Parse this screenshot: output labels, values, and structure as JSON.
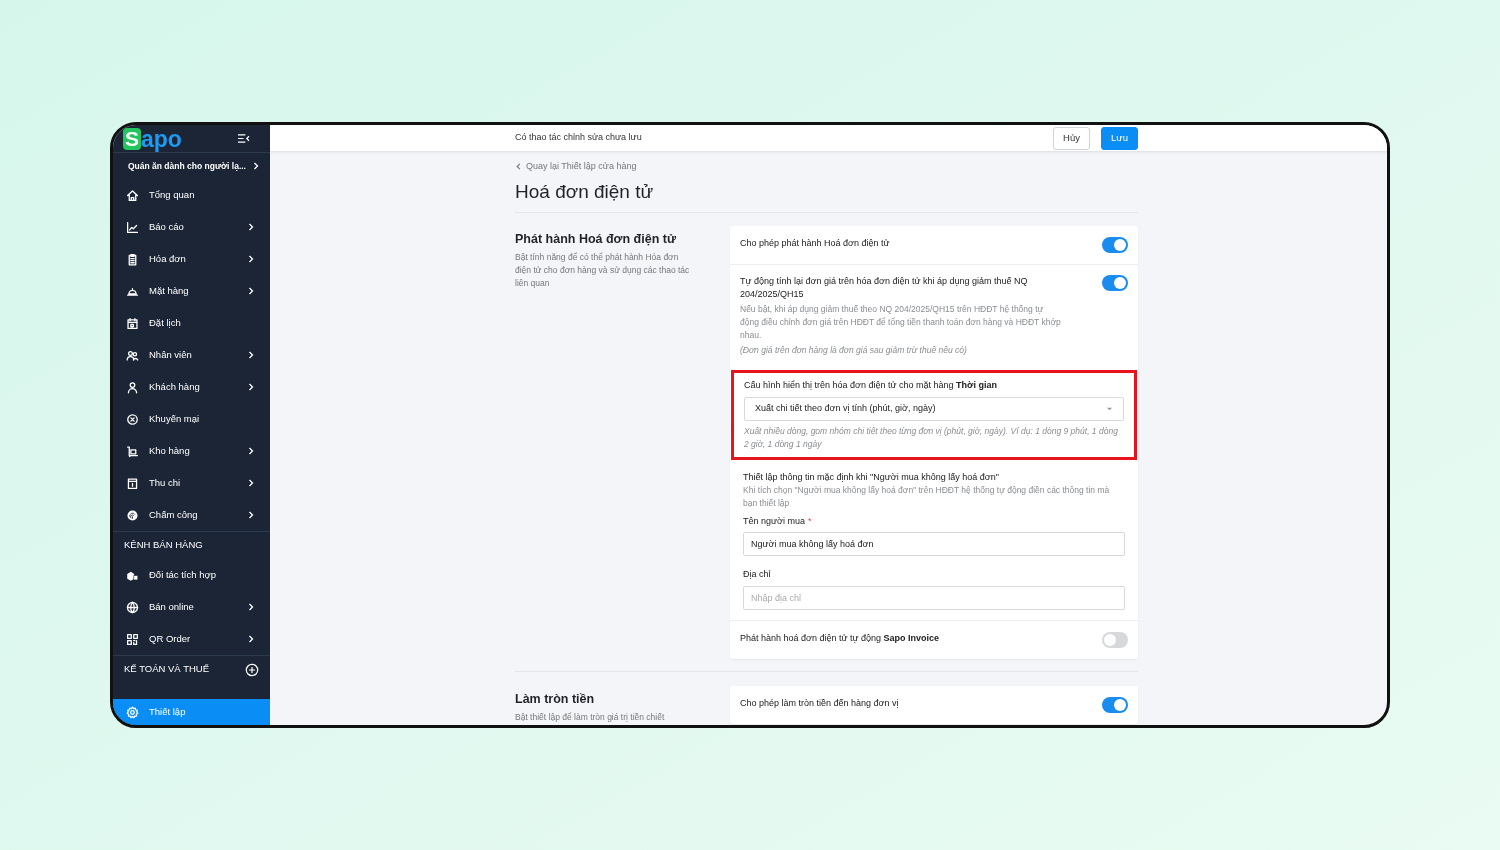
{
  "sidebar": {
    "logo": {
      "initial": "S",
      "rest": "apo"
    },
    "store": "Quán ăn dành cho người lạ...",
    "items": [
      {
        "kind": "item",
        "label": "Tổng quan",
        "expandable": false,
        "selected": false
      },
      {
        "kind": "item",
        "label": "Báo cáo",
        "expandable": true,
        "selected": false
      },
      {
        "kind": "item",
        "label": "Hóa đơn",
        "expandable": true,
        "selected": false
      },
      {
        "kind": "item",
        "label": "Mặt hàng",
        "expandable": true,
        "selected": false
      },
      {
        "kind": "item",
        "label": "Đặt lịch",
        "expandable": false,
        "selected": false
      },
      {
        "kind": "item",
        "label": "Nhân viên",
        "expandable": true,
        "selected": false
      },
      {
        "kind": "item",
        "label": "Khách hàng",
        "expandable": true,
        "selected": false
      },
      {
        "kind": "item",
        "label": "Khuyến mại",
        "expandable": false,
        "selected": false
      },
      {
        "kind": "item",
        "label": "Kho hàng",
        "expandable": true,
        "selected": false
      },
      {
        "kind": "item",
        "label": "Thu chi",
        "expandable": true,
        "selected": false
      },
      {
        "kind": "item",
        "label": "Chấm công",
        "expandable": true,
        "selected": false
      },
      {
        "kind": "heading",
        "label": "KÊNH BÁN HÀNG",
        "addable": false
      },
      {
        "kind": "item",
        "label": "Đối tác tích hợp",
        "expandable": false,
        "selected": false
      },
      {
        "kind": "item",
        "label": "Bán online",
        "expandable": true,
        "selected": false
      },
      {
        "kind": "item",
        "label": "QR Order",
        "expandable": true,
        "selected": false
      },
      {
        "kind": "heading",
        "label": "KẾ TOÁN VÀ THUẾ",
        "addable": true
      }
    ],
    "pinned": {
      "label": "Thiết lập",
      "selected": true
    }
  },
  "top_bar": {
    "notice": "Có thao tác chỉnh sửa chưa lưu",
    "buttons": [
      {
        "label": "Hủy",
        "kind": "secondary"
      },
      {
        "label": "Lưu",
        "kind": "primary"
      }
    ]
  },
  "breadcrumb": "Quay lại Thiết lập cửa hàng",
  "title": "Hoá đơn điện tử",
  "sections": [
    {
      "title": "Phát hành Hoá đơn điện tử",
      "description": "Bật tính năng để có thể phát hành Hóa đơn điện tử cho đơn hàng và sử dụng các thao tác liên quan",
      "rows": [
        {
          "kind": "toggle",
          "label": "Cho phép phát hành Hoá đơn điện tử",
          "on": true
        },
        {
          "kind": "toggle",
          "label": "Tự động tính lại đơn giá trên hóa đơn điện tử khi áp dụng giảm thuế NQ 204/2025/QH15",
          "on": true,
          "description": "Nếu bật, khi áp dụng giảm thuế theo NQ 204/2025/QH15 trên HĐĐT hệ thống tự động điều chỉnh đơn giá trên HĐĐT để tổng tiền thanh toán đơn hàng và HĐĐT khớp nhau.",
          "note": "(Đơn giá trên đơn hàng là đơn giá sau giảm trừ thuế nếu có)"
        },
        {
          "kind": "select",
          "label": "Cấu hình hiển thị trên hóa đơn điện tử cho mặt hàng **Thời gian**",
          "value": "Xuất chi tiết theo đơn vị tính (phút, giờ, ngày)",
          "hint": "Xuất nhiều dòng, gom nhóm chi tiết theo từng đơn vị (phút, giờ, ngày). Ví dụ: 1 dòng 9 phút, 1 dòng 2 giờ, 1 dòng 1 ngày",
          "highlighted": true
        },
        {
          "kind": "form",
          "title": "Thiết lập thông tin mặc định khi \"Người mua không lấy hoá đơn\"",
          "description": "Khi tích chọn \"Người mua không lấy hoá đơn\" trên HĐĐT hệ thống tự động điền các thông tin mà bạn thiết lập",
          "fields": [
            {
              "label": "Tên người mua",
              "required_mark": "*",
              "value": "Người mua không lấy hoá đơn"
            },
            {
              "label": "Địa chỉ",
              "placeholder": "Nhập địa chỉ"
            }
          ]
        },
        {
          "kind": "toggle",
          "label": "Phát hành hoá đơn điện tử tự động **Sapo Invoice**",
          "on": false
        }
      ]
    },
    {
      "title": "Làm tròn tiền",
      "description": "Bật thiết lập để làm tròn giá trị tiền chiết",
      "rows": [
        {
          "kind": "toggle",
          "label": "Cho phép làm tròn tiền đến hàng đơn vị",
          "on": true
        }
      ]
    }
  ]
}
